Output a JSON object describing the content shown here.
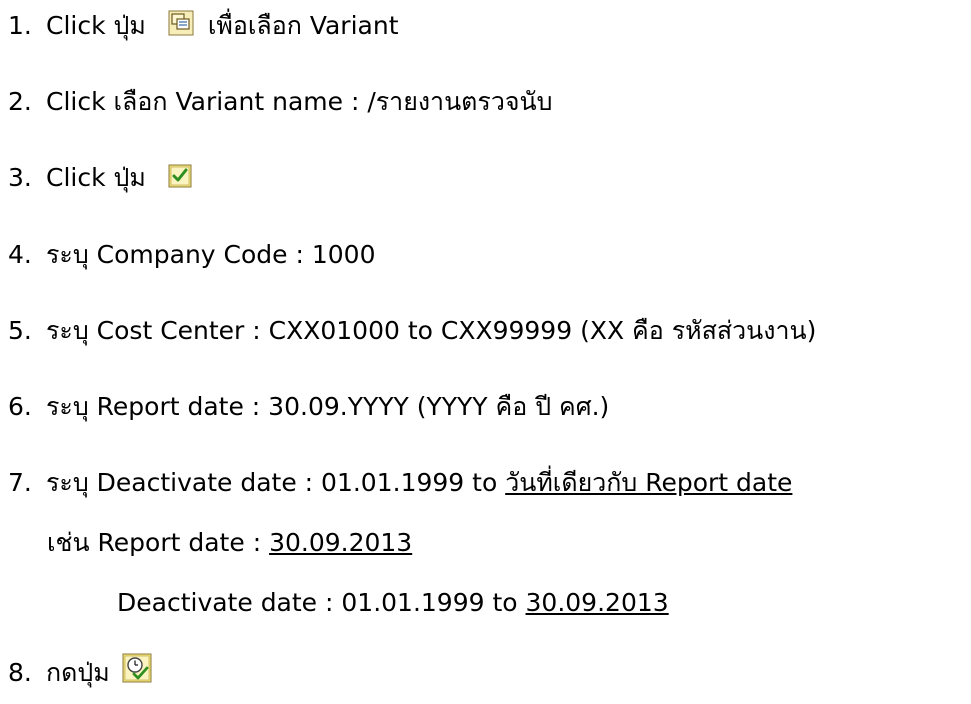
{
  "steps": [
    {
      "num": "1.",
      "a": "Click ปุ่ม",
      "b": "เพื่อเลือก Variant",
      "icon": "get-variant-icon"
    },
    {
      "num": "2.",
      "a": "Click เลือก  Variant name : /รายงานตรวจนับ"
    },
    {
      "num": "3.",
      "a": "Click ปุ่ม",
      "icon": "confirm-check-icon"
    },
    {
      "num": "4.",
      "a": "ระบุ Company Code : 1000"
    },
    {
      "num": "5.",
      "a": "ระบุ Cost Center : CXX01000  to  CXX99999  (XX คือ รหัสส่วนงาน)"
    },
    {
      "num": "6.",
      "a": "ระบุ Report date : 30.09.YYYY  (YYYY คือ ปี คศ.)"
    },
    {
      "num": "7.",
      "a": "ระบุ Deactivate date : 01.01.1999 to ",
      "u": "วันที่เดียวกับ Report date"
    },
    {
      "a": "เช่น Report date : ",
      "u": "30.09.2013"
    },
    {
      "a": "Deactivate date : 01.01.1999 to ",
      "u": "30.09.2013"
    },
    {
      "num": "8.",
      "a": "กดปุ่ม",
      "icon": "execute-clock-icon"
    }
  ],
  "colors": {
    "text": "#000000",
    "icon_yellow": "#f3e27a",
    "icon_green": "#2f8f1f"
  }
}
